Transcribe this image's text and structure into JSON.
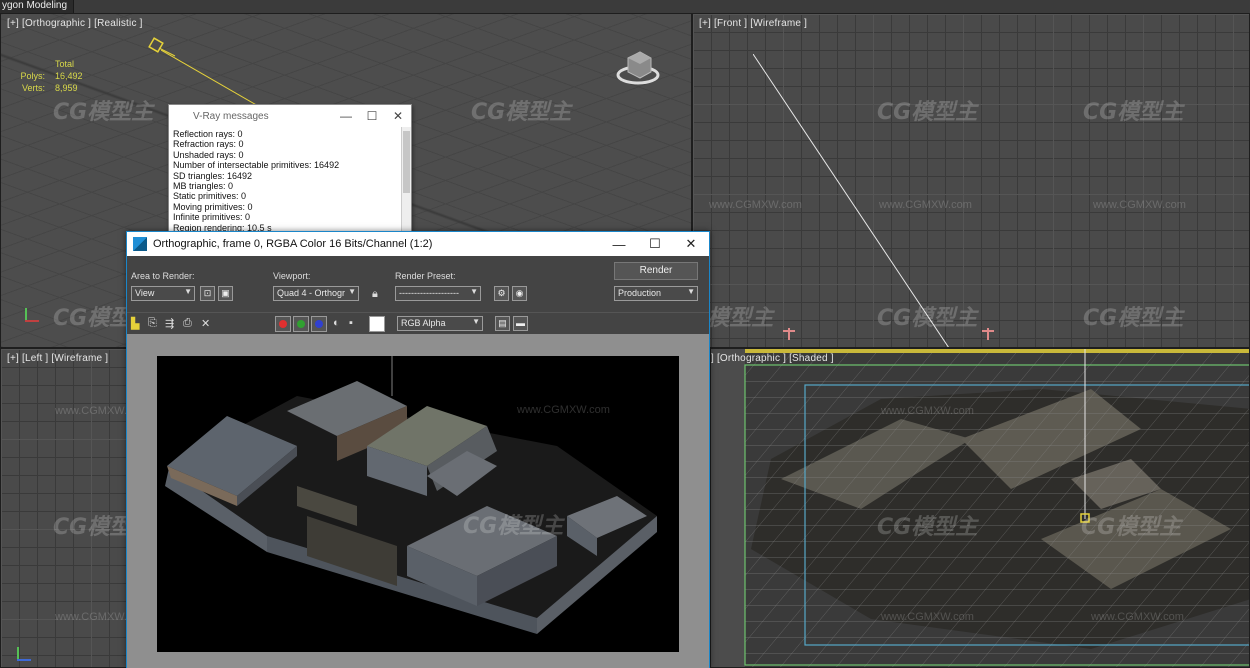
{
  "app": {
    "mode_title": "ygon Modeling"
  },
  "viewports": {
    "top_left": {
      "label": "[+] [Orthographic ] [Realistic ]"
    },
    "top_right": {
      "label": "[+] [Front ] [Wireframe ]"
    },
    "bottom_left": {
      "label": "[+] [Left ] [Wireframe ]"
    },
    "bottom_right": {
      "label": "] [Orthographic ] [Shaded ]"
    }
  },
  "stats": {
    "header": "Total",
    "polys_label": "Polys:",
    "polys_value": "16,492",
    "verts_label": "Verts:",
    "verts_value": "8,959"
  },
  "watermark": {
    "logo": "CG模型主",
    "url": "www.CGMXW.com"
  },
  "vray_messages": {
    "title": "V-Ray messages",
    "lines": [
      "Reflection rays: 0",
      "Refraction rays: 0",
      "Unshaded rays: 0",
      "Number of intersectable primitives: 16492",
      "SD triangles: 16492",
      "MB triangles: 0",
      "Static primitives: 0",
      "Moving primitives: 0",
      "Infinite primitives: 0",
      "Region rendering: 10.5 s"
    ]
  },
  "frame_buffer": {
    "title": "Orthographic, frame 0, RGBA Color 16 Bits/Channel (1:2)",
    "area_to_render_label": "Area to Render:",
    "area_to_render_value": "View",
    "viewport_label": "Viewport:",
    "viewport_value": "Quad 4 - Orthogr",
    "render_preset_label": "Render Preset:",
    "render_preset_value": "--------------------",
    "render_button": "Render",
    "production_value": "Production",
    "channel_value": "RGB Alpha"
  },
  "colors": {
    "viewport_bg": "#4a4a4a",
    "accent_blue": "#1a86c9",
    "stats_yellow": "#d9d94a"
  }
}
